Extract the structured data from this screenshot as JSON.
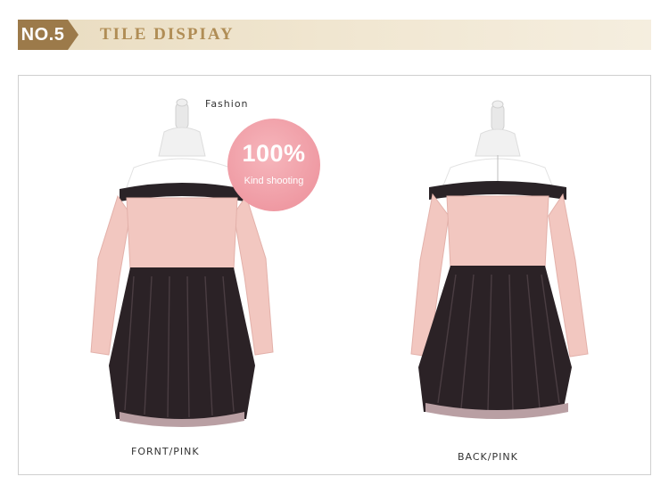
{
  "banner": {
    "number": "NO.5",
    "title": "TILE DISPIAY"
  },
  "badge": {
    "big": "100%",
    "small": "Kind shooting"
  },
  "photos": [
    {
      "caption": "FORNT/PINK",
      "brand_text": "Fashion"
    },
    {
      "caption": "BACK/PINK"
    }
  ],
  "colors": {
    "banner_accent": "#9c7a4a",
    "badge_pink": "#ef9aa3",
    "dress_pink": "#f2c7c0",
    "tulle": "#2b2226"
  }
}
